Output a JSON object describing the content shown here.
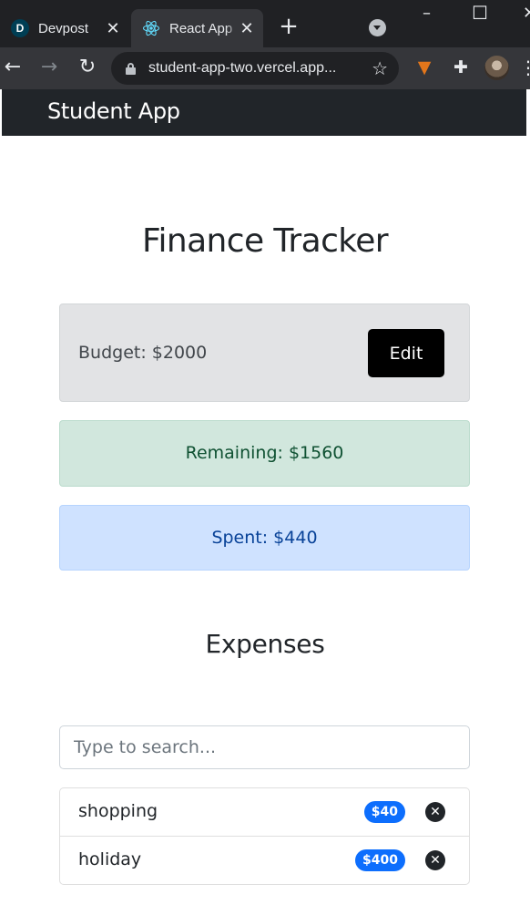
{
  "browser": {
    "tabs": [
      {
        "favicon": "D",
        "title": "Devpost"
      },
      {
        "favicon": "react-icon",
        "title": "React App"
      }
    ],
    "url": "student-app-two.vercel.app..."
  },
  "navbar": {
    "brand": "Student App"
  },
  "main": {
    "title": "Finance Tracker",
    "budget_label": "Budget: $2000",
    "edit_label": "Edit",
    "remaining_label": "Remaining: $1560",
    "spent_label": "Spent: $440"
  },
  "expenses": {
    "heading": "Expenses",
    "search_placeholder": "Type to search...",
    "items": [
      {
        "name": "shopping",
        "cost": "$40"
      },
      {
        "name": "holiday",
        "cost": "$400"
      }
    ]
  },
  "colors": {
    "navbar": "#212529",
    "budget_bg": "#e2e3e5",
    "remaining_bg": "#d1e7dd",
    "spent_bg": "#cfe2ff",
    "badge": "#0d6efd",
    "edit_button": "#000000"
  }
}
